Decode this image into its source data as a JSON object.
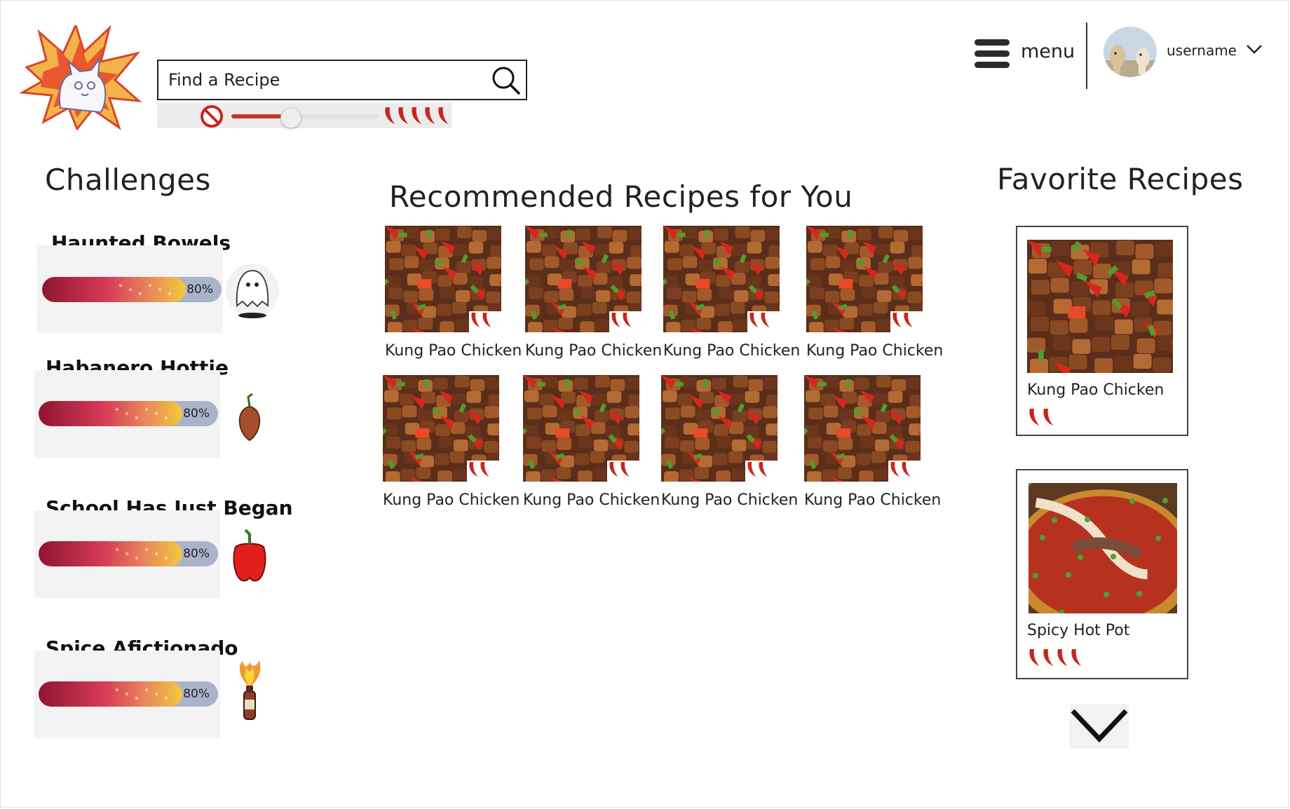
{
  "header": {
    "search_placeholder": "Find a Recipe",
    "spice_level": 0.4,
    "menu_label": "menu",
    "username": "username"
  },
  "challenges": {
    "title": "Challenges",
    "items": [
      {
        "name": "Haunted Bowels",
        "progress": 0.8,
        "progress_label": "80%",
        "icon": "ghost-icon"
      },
      {
        "name": "Habanero Hottie",
        "progress": 0.8,
        "progress_label": "80%",
        "icon": "habanero-icon"
      },
      {
        "name": "School Has Just Began",
        "progress": 0.8,
        "progress_label": "80%",
        "icon": "bell-pepper-icon"
      },
      {
        "name": "Spice Afictionado",
        "progress": 0.8,
        "progress_label": "80%",
        "icon": "hot-sauce-icon"
      }
    ]
  },
  "recommended": {
    "title": "Recommended Recipes for You",
    "items": [
      {
        "name": "Kung Pao Chicken",
        "spice": 2
      },
      {
        "name": "Kung Pao Chicken",
        "spice": 2
      },
      {
        "name": "Kung Pao Chicken",
        "spice": 2
      },
      {
        "name": "Kung Pao Chicken",
        "spice": 2
      },
      {
        "name": "Kung Pao Chicken",
        "spice": 2
      },
      {
        "name": "Kung Pao Chicken",
        "spice": 2
      },
      {
        "name": "Kung Pao Chicken",
        "spice": 2
      },
      {
        "name": "Kung Pao Chicken",
        "spice": 2
      }
    ]
  },
  "favorites": {
    "title": "Favorite Recipes",
    "items": [
      {
        "name": "Kung Pao Chicken",
        "spice": 2
      },
      {
        "name": "Spicy Hot Pot",
        "spice": 4
      }
    ]
  },
  "colors": {
    "pepper": "#c8261b",
    "progress_track": "#a9b3c9",
    "accent": "#c13a23"
  }
}
